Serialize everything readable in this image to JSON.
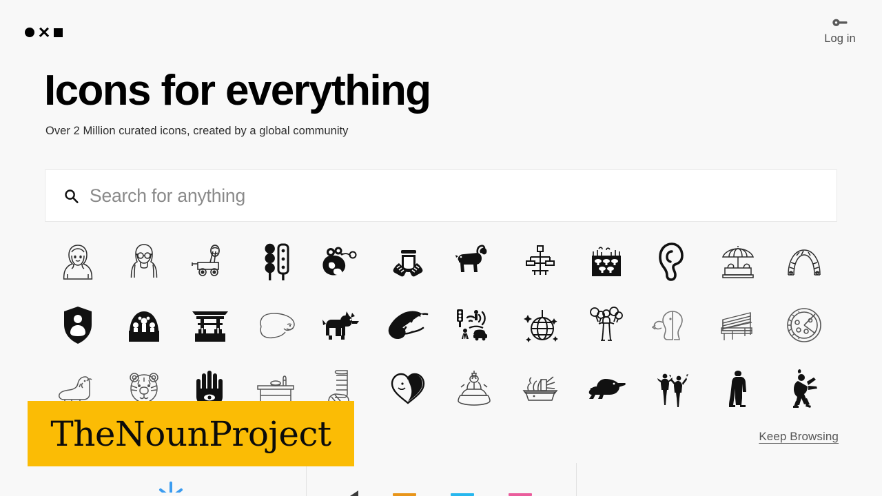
{
  "header": {
    "logo": {
      "name": "noun-project-logo",
      "shapes": [
        "circle",
        "x",
        "square"
      ]
    },
    "login": {
      "icon": "key-icon",
      "label": "Log in"
    }
  },
  "hero": {
    "title": "Icons for everything",
    "subtitle": "Over 2 Million curated icons, created by a global community"
  },
  "search": {
    "icon": "search-icon",
    "value": "",
    "placeholder": "Search for anything"
  },
  "icon_grid": {
    "rows": 3,
    "columns": 12,
    "items": [
      {
        "name": "woman-hijab-icon"
      },
      {
        "name": "woman-glasses-icon"
      },
      {
        "name": "catapult-cart-icon"
      },
      {
        "name": "traffic-lights-icon"
      },
      {
        "name": "singing-mouse-icon"
      },
      {
        "name": "hands-jar-icon"
      },
      {
        "name": "goat-icon"
      },
      {
        "name": "circuit-fountain-icon"
      },
      {
        "name": "mushroom-farm-icon"
      },
      {
        "name": "ear-icon"
      },
      {
        "name": "sandbox-umbrella-icon"
      },
      {
        "name": "arched-bridge-icon"
      },
      {
        "name": "shield-person-icon"
      },
      {
        "name": "fountain-icon"
      },
      {
        "name": "torii-gate-icon"
      },
      {
        "name": "polar-bear-icon"
      },
      {
        "name": "scottish-terrier-icon"
      },
      {
        "name": "lizard-icon"
      },
      {
        "name": "smart-city-traffic-icon"
      },
      {
        "name": "disco-ball-icon"
      },
      {
        "name": "person-balloons-icon"
      },
      {
        "name": "ghost-blowing-icon"
      },
      {
        "name": "park-bench-icon"
      },
      {
        "name": "pizza-icon"
      },
      {
        "name": "walrus-icon"
      },
      {
        "name": "tiger-face-icon"
      },
      {
        "name": "hamsa-hand-icon"
      },
      {
        "name": "console-table-icon"
      },
      {
        "name": "leg-cast-icon"
      },
      {
        "name": "heart-face-icon"
      },
      {
        "name": "buddha-statue-icon"
      },
      {
        "name": "food-dish-icon"
      },
      {
        "name": "duck-icon"
      },
      {
        "name": "two-dancers-icon"
      },
      {
        "name": "standing-person-icon"
      },
      {
        "name": "dancing-person-icon"
      }
    ]
  },
  "keep_browsing": {
    "label": "Keep Browsing"
  },
  "bottom": {
    "columns": [
      {
        "name": "bottom-col-1",
        "accents": [
          "#3B9CF0"
        ]
      },
      {
        "name": "bottom-col-2",
        "accents": [
          "#3B3B3B",
          "#E8951A",
          "#27B7EE",
          "#EA5D9C"
        ]
      },
      {
        "name": "bottom-col-3",
        "accents": []
      }
    ]
  },
  "watermark": {
    "text": "TheNounProject",
    "background": "#FBBC05"
  },
  "colors": {
    "page_background": "#F8F8F8",
    "search_background": "#FFFFFF",
    "search_border": "#E8E8E8",
    "text_primary": "#000000",
    "text_secondary": "#4A4A4A",
    "placeholder": "#8A8A8A",
    "divider": "#E2E2E2",
    "watermark_yellow": "#FBBC05"
  }
}
